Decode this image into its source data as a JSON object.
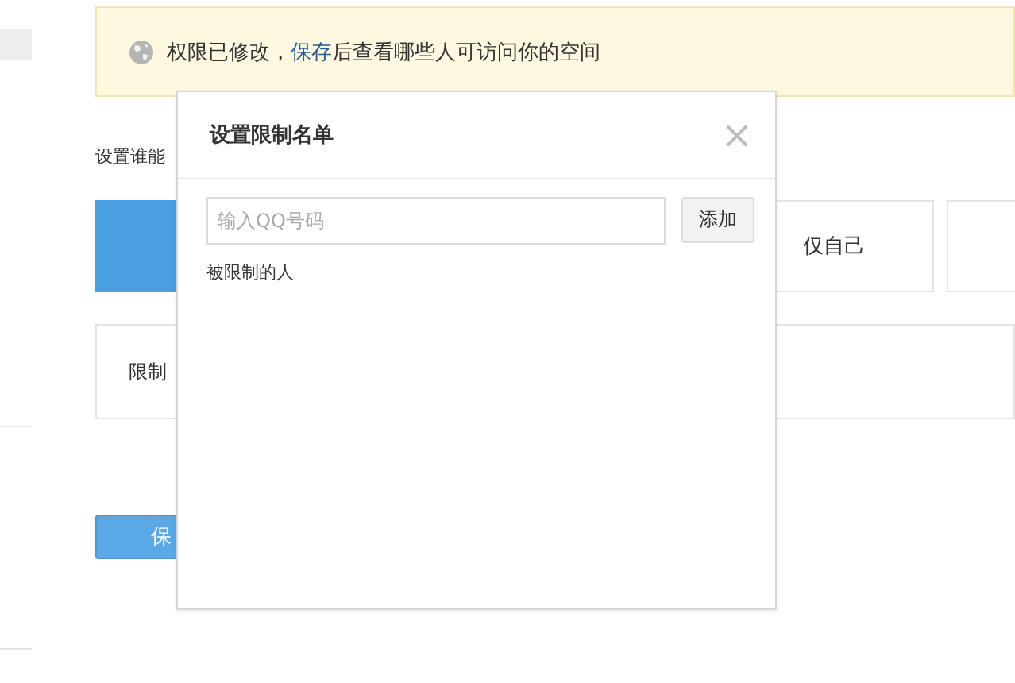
{
  "notice": {
    "link": "保存",
    "before": "权限已修改，",
    "after": "后查看哪些人可访问你的空间"
  },
  "section_label": "设置谁能",
  "options": [
    {
      "selected": true
    },
    {
      "label": "仅自己",
      "selected": false
    },
    {
      "selected": false
    }
  ],
  "restriction_label": "限制",
  "save_button": "保",
  "dialog": {
    "title": "设置限制名单",
    "close": "×",
    "input_placeholder": "输入QQ号码",
    "add_button": "添加",
    "list_label": "被限制的人"
  }
}
